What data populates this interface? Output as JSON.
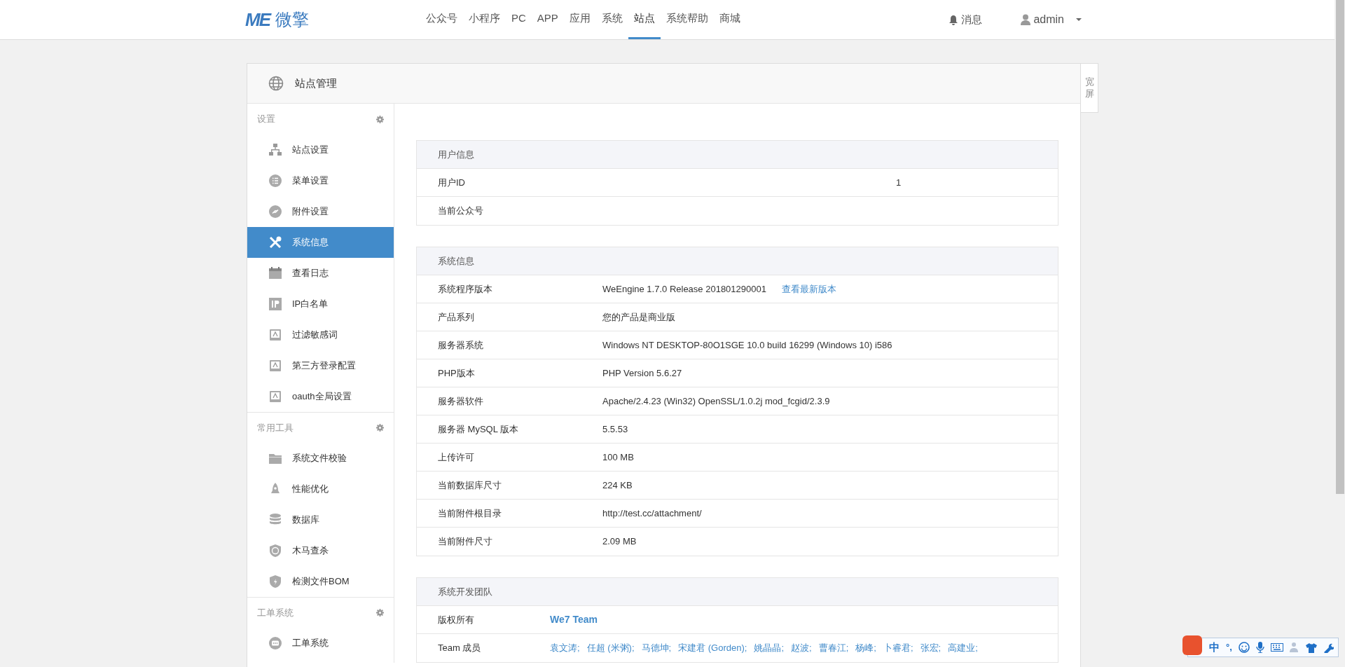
{
  "nav": {
    "logo_mark": "ME",
    "logo_text": "微擎",
    "items": [
      {
        "label": "公众号",
        "selected": false
      },
      {
        "label": "小程序",
        "selected": false
      },
      {
        "label": "PC",
        "selected": false
      },
      {
        "label": "APP",
        "selected": false
      },
      {
        "label": "应用",
        "selected": false
      },
      {
        "label": "系统",
        "selected": false
      },
      {
        "label": "站点",
        "selected": true
      },
      {
        "label": "系统帮助",
        "selected": false
      },
      {
        "label": "商城",
        "selected": false
      }
    ],
    "messages": "消息",
    "user": "admin"
  },
  "page": {
    "title": "站点管理",
    "wide_toggle": "宽屏"
  },
  "sidebar": {
    "groups": [
      {
        "title": "设置",
        "items": [
          {
            "label": "站点设置",
            "kind": "sitemap",
            "selected": false
          },
          {
            "label": "菜单设置",
            "kind": "list",
            "selected": false
          },
          {
            "label": "附件设置",
            "kind": "link",
            "selected": false
          },
          {
            "label": "系统信息",
            "kind": "tools",
            "selected": true
          },
          {
            "label": "查看日志",
            "kind": "calendar",
            "selected": false
          },
          {
            "label": "IP白名单",
            "kind": "badge",
            "selected": false
          },
          {
            "label": "过滤敏感词",
            "kind": "book",
            "selected": false
          },
          {
            "label": "第三方登录配置",
            "kind": "book",
            "selected": false
          },
          {
            "label": "oauth全局设置",
            "kind": "book",
            "selected": false
          }
        ]
      },
      {
        "title": "常用工具",
        "items": [
          {
            "label": "系统文件校验",
            "kind": "folder",
            "selected": false
          },
          {
            "label": "性能优化",
            "kind": "rocket",
            "selected": false
          },
          {
            "label": "数据库",
            "kind": "database",
            "selected": false
          },
          {
            "label": "木马查杀",
            "kind": "shield",
            "selected": false
          },
          {
            "label": "检测文件BOM",
            "kind": "bolt",
            "selected": false
          }
        ]
      },
      {
        "title": "工单系统",
        "items": [
          {
            "label": "工单系统",
            "kind": "chat",
            "selected": false
          }
        ]
      }
    ]
  },
  "sections": [
    {
      "title": "用户信息",
      "kind": "wide",
      "rows": [
        {
          "label": "用户ID",
          "value": "1"
        },
        {
          "label": "当前公众号"
        }
      ]
    },
    {
      "title": "系统信息",
      "kind": "normal",
      "rows": [
        {
          "label": "系统程序版本",
          "value": "WeEngine 1.7.0 Release 201801290001",
          "link": "查看最新版本"
        },
        {
          "label": "产品系列",
          "value": "您的产品是商业版"
        },
        {
          "label": "服务器系统",
          "value": "Windows NT DESKTOP-80O1SGE 10.0 build 16299 (Windows 10) i586"
        },
        {
          "label": "PHP版本",
          "value": "PHP Version 5.6.27"
        },
        {
          "label": "服务器软件",
          "value": "Apache/2.4.23 (Win32) OpenSSL/1.0.2j mod_fcgid/2.3.9"
        },
        {
          "label": "服务器 MySQL 版本",
          "value": "5.5.53"
        },
        {
          "label": "上传许可",
          "value": "100 MB"
        },
        {
          "label": "当前数据库尺寸",
          "value": "224 KB"
        },
        {
          "label": "当前附件根目录",
          "value": "http://test.cc/attachment/"
        },
        {
          "label": "当前附件尺寸",
          "value": "2.09 MB"
        }
      ]
    },
    {
      "title": "系统开发团队",
      "kind": "narrow",
      "rows": [
        {
          "label": "版权所有",
          "owner": "We7 Team"
        },
        {
          "label": "Team 成员",
          "members": [
            "袁文涛;",
            "任超 (米粥);",
            "马德坤;",
            "宋建君 (Gorden);",
            "姚晶晶;",
            "赵波;",
            "曹春江;",
            "杨峰;",
            "卜睿君;",
            "张宏;",
            "高建业;"
          ]
        }
      ]
    }
  ],
  "ime_toolbar": {
    "mode": "中",
    "punctuation": "°,"
  }
}
